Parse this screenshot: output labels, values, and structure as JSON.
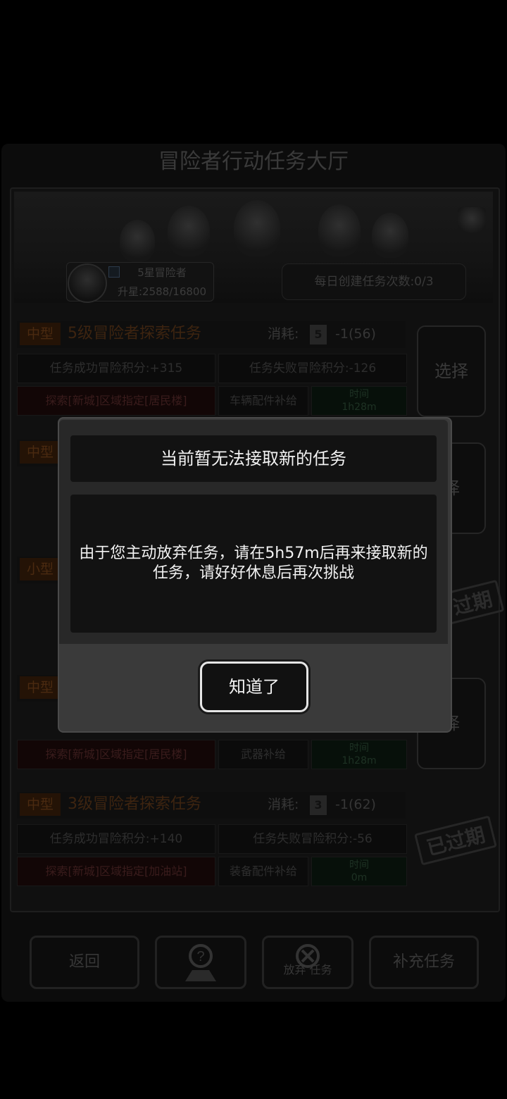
{
  "hall": {
    "title": "冒险者行动任务大厅",
    "rank": "5星冒险者",
    "exp": "升星:2588/16800",
    "daily": "每日创建任务次数:0/3"
  },
  "tasks": [
    {
      "tag": "中型",
      "name": "5级冒险者探索任务",
      "cost_label": "消耗:",
      "dice": "5",
      "cost": "-1(56)",
      "success": "任务成功冒险积分:+315",
      "fail": "任务失败冒险积分:-126",
      "area": "探索[新城]区域指定[居民楼]",
      "reward": "车辆配件补给",
      "time_label": "时间",
      "time": "1h28m",
      "action": "选择"
    },
    {
      "tag": "中型",
      "action": "择"
    },
    {
      "tag": "小型",
      "stamp": "过期"
    },
    {
      "tag": "中型",
      "area": "探索[新城]区域指定[居民楼]",
      "reward": "武器补给",
      "time_label": "时间",
      "time": "1h28m",
      "action": "择"
    },
    {
      "tag": "中型",
      "name": "3级冒险者探索任务",
      "cost_label": "消耗:",
      "dice": "3",
      "cost": "-1(62)",
      "success": "任务成功冒险积分:+140",
      "fail": "任务失败冒险积分:-56",
      "area": "探索[新城]区域指定[加油站]",
      "reward": "装备配件补给",
      "time_label": "时间",
      "time": "0m",
      "stamp": "已过期"
    }
  ],
  "bottom": {
    "back": "返回",
    "abandon": "放弃 任务",
    "refill": "补充任务"
  },
  "dialog": {
    "title": "当前暂无法接取新的任务",
    "message": "由于您主动放弃任务，请在5h57m后再来接取新的任务，请好好休息后再次挑战",
    "ok": "知道了"
  }
}
